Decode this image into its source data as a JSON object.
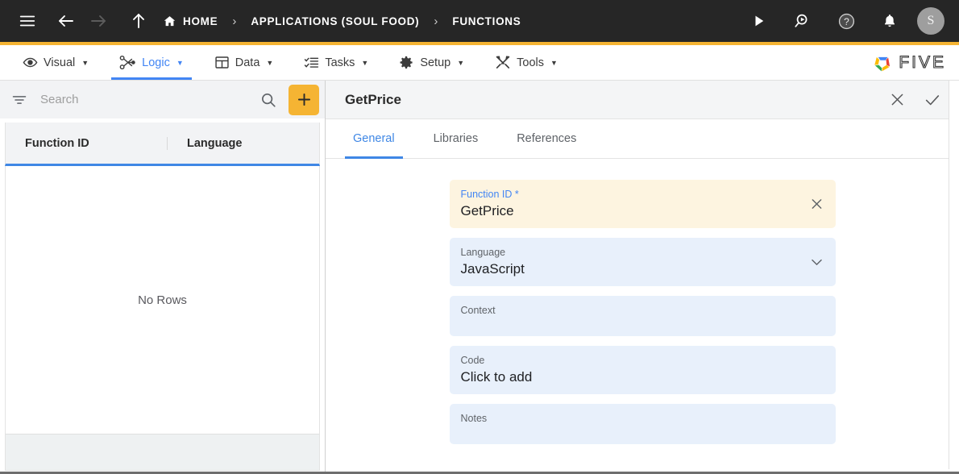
{
  "topbar": {
    "menu_icon": "hamburger-menu-icon",
    "back_icon": "arrow-left-icon",
    "forward_icon": "arrow-right-icon",
    "up_icon": "arrow-up-icon",
    "breadcrumbs": [
      {
        "label": "HOME",
        "icon": "home-icon"
      },
      {
        "label": "APPLICATIONS (SOUL FOOD)",
        "icon": ""
      },
      {
        "label": "FUNCTIONS",
        "icon": ""
      }
    ],
    "separator": "›",
    "actions": [
      {
        "name": "run-icon",
        "title": "Run"
      },
      {
        "name": "search-run-icon",
        "title": "Search"
      },
      {
        "name": "help-icon",
        "title": "Help"
      },
      {
        "name": "notifications-bell-icon",
        "title": "Notifications"
      }
    ],
    "avatar_initial": "S"
  },
  "menubar": {
    "items": [
      {
        "label": "Visual",
        "icon": "eye-icon",
        "active": false
      },
      {
        "label": "Logic",
        "icon": "logic-nodes-icon",
        "active": true
      },
      {
        "label": "Data",
        "icon": "table-grid-icon",
        "active": false
      },
      {
        "label": "Tasks",
        "icon": "task-list-icon",
        "active": false
      },
      {
        "label": "Setup",
        "icon": "gear-icon",
        "active": false
      },
      {
        "label": "Tools",
        "icon": "tools-wrench-icon",
        "active": false
      }
    ],
    "caret": "▼",
    "brand": "FIVE"
  },
  "sidebar": {
    "filter_icon": "filter-icon",
    "search_placeholder": "Search",
    "search_value": "",
    "search_icon": "search-icon",
    "add_label": "+",
    "columns": [
      "Function ID",
      "Language"
    ],
    "rows": [],
    "empty_text": "No Rows"
  },
  "panel": {
    "title": "GetPrice",
    "close_icon": "close-icon",
    "confirm_icon": "check-icon",
    "tabs": [
      {
        "label": "General",
        "active": true
      },
      {
        "label": "Libraries",
        "active": false
      },
      {
        "label": "References",
        "active": false
      }
    ],
    "fields": [
      {
        "label": "Function ID",
        "required": true,
        "value": "GetPrice",
        "icon": "clear-x-icon",
        "state": "focused"
      },
      {
        "label": "Language",
        "required": false,
        "value": "JavaScript",
        "icon": "chevron-down-icon",
        "state": "normal"
      },
      {
        "label": "Context",
        "required": false,
        "value": "",
        "icon": "",
        "state": "normal"
      },
      {
        "label": "Code",
        "required": false,
        "value": "Click to add",
        "icon": "",
        "state": "normal"
      },
      {
        "label": "Notes",
        "required": false,
        "value": "",
        "icon": "",
        "state": "normal"
      }
    ],
    "required_marker": " *"
  },
  "colors": {
    "accent_amber": "#f5b433",
    "accent_blue": "#3f87e5",
    "topbar_bg": "#262626",
    "focused_field_bg": "#fdf4e0",
    "field_bg": "#e8f0fb"
  }
}
